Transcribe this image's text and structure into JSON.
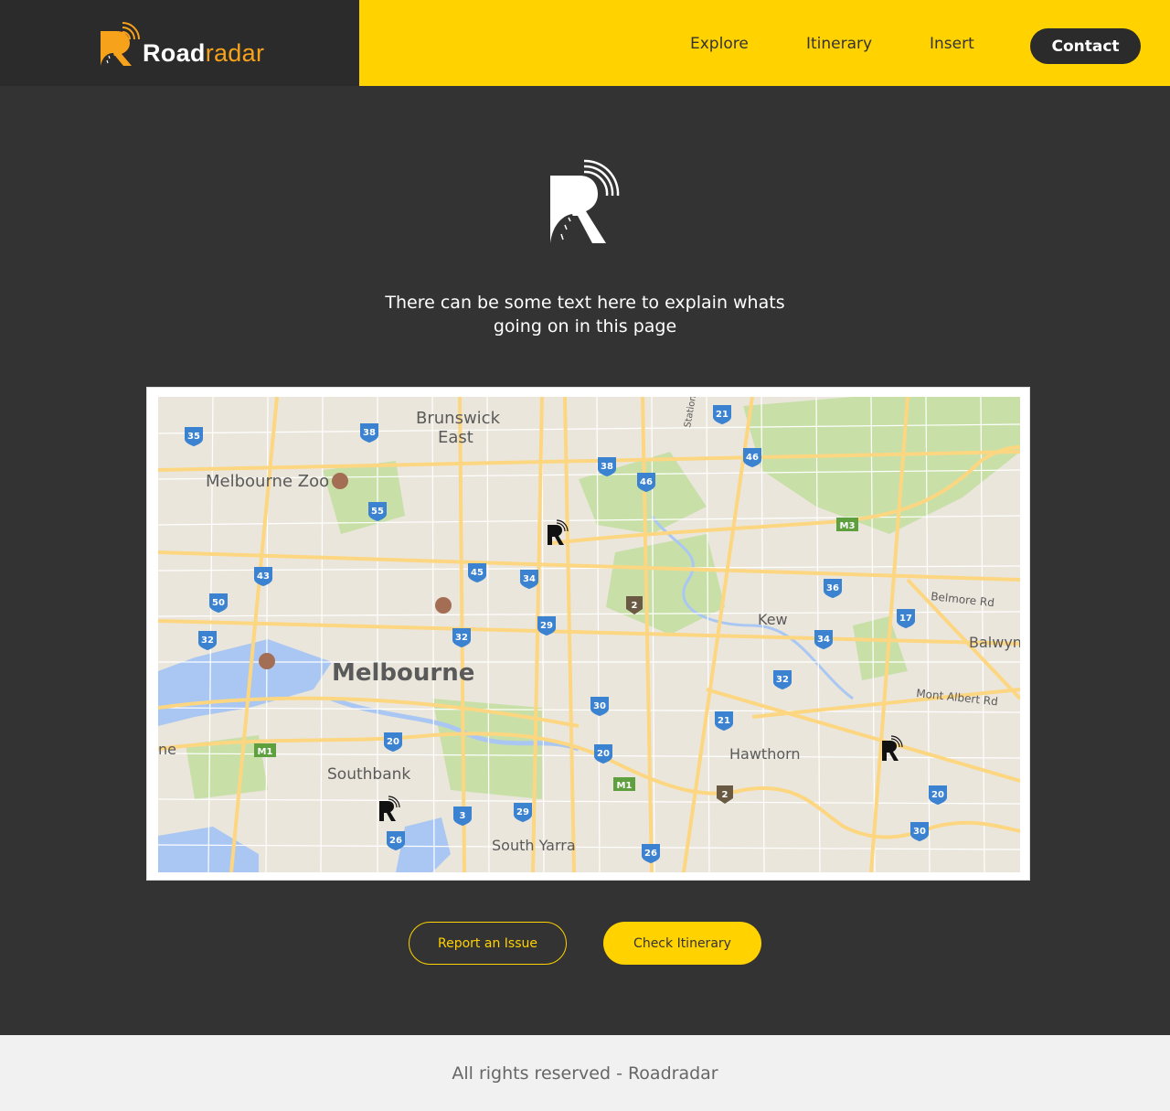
{
  "header": {
    "brand_strong": "Road",
    "brand_light": "radar",
    "nav": {
      "explore": "Explore",
      "itinerary": "Itinerary",
      "insert": "Insert",
      "contact": "Contact"
    },
    "colors": {
      "nav_bg": "#ffd200",
      "brand_bg": "#2b2b2b",
      "accent": "#f7a21b"
    }
  },
  "hero": {
    "intro_text": "There can be some text here to explain whats going on in this page"
  },
  "map": {
    "labels": {
      "brunswick_east_1": "Brunswick",
      "brunswick_east_2": "East",
      "melbourne_zoo": "Melbourne Zoo",
      "melbourne": "Melbourne",
      "southbank": "Southbank",
      "south_yarra": "South Yarra",
      "kew": "Kew",
      "hawthorn": "Hawthorn",
      "balwyn": "Balwyn",
      "belmore_rd": "Belmore Rd",
      "mont_albert_rd": "Mont Albert Rd",
      "station": "Station",
      "edge_text": "ne"
    },
    "routes": {
      "r35": "35",
      "r38a": "38",
      "r21a": "21",
      "r46a": "46",
      "r38b": "38",
      "r46b": "46",
      "r55": "55",
      "m3": "M3",
      "r43": "43",
      "r45": "45",
      "r34a": "34",
      "r36": "36",
      "r50": "50",
      "r2a": "2",
      "r17": "17",
      "r32a": "32",
      "r29a": "29",
      "r34b": "34",
      "r32b": "32",
      "r30a": "30",
      "r21b": "21",
      "r20a": "20",
      "m1a": "M1",
      "r20b": "20",
      "m1b": "M1",
      "r2b": "2",
      "r20c": "20",
      "r3": "3",
      "r29b": "29",
      "r26a": "26",
      "r30b": "30",
      "r26b": "26"
    },
    "marker_icon": "roadradar-marker-icon"
  },
  "actions": {
    "report": "Report an Issue",
    "check_itinerary": "Check Itinerary"
  },
  "footer": {
    "text": "All rights reserved - Roadradar"
  }
}
